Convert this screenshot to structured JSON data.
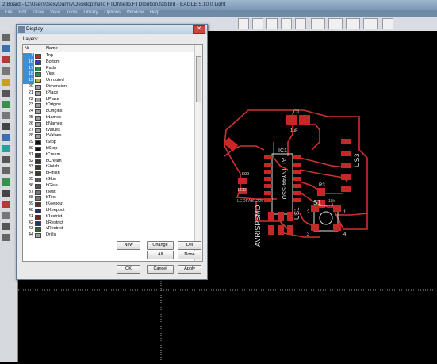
{
  "window": {
    "title": "2 Board - C:\\Users\\SexyDanny\\Desktop\\hello FTDI\\hello.FTDIbutton.fab.brd - EAGLE 5.10.0 Light"
  },
  "menu": [
    "File",
    "Edit",
    "Draw",
    "View",
    "Tools",
    "Library",
    "Options",
    "Window",
    "Help"
  ],
  "dialog": {
    "title": "Display",
    "layers_label": "Layers:",
    "columns": {
      "nr": "Nr",
      "name": "Name"
    },
    "layers": [
      {
        "nr": "1",
        "name": "Top",
        "color": "#c62828",
        "sel": true
      },
      {
        "nr": "16",
        "name": "Bottom",
        "color": "#1e3fcf",
        "sel": true
      },
      {
        "nr": "17",
        "name": "Pads",
        "color": "#2a8f4a",
        "sel": true
      },
      {
        "nr": "18",
        "name": "Vias",
        "color": "#2a8f4a",
        "sel": true
      },
      {
        "nr": "19",
        "name": "Unrouted",
        "color": "#c2b13a",
        "sel": true
      },
      {
        "nr": "20",
        "name": "Dimension",
        "color": "#9e9e9e"
      },
      {
        "nr": "21",
        "name": "tPlace",
        "color": "#9e9e9e"
      },
      {
        "nr": "22",
        "name": "bPlace",
        "color": "#9e9e9e"
      },
      {
        "nr": "23",
        "name": "tOrigins",
        "color": "#9e9e9e"
      },
      {
        "nr": "24",
        "name": "bOrigins",
        "color": "#9e9e9e"
      },
      {
        "nr": "25",
        "name": "tNames",
        "color": "#9e9e9e"
      },
      {
        "nr": "26",
        "name": "bNames",
        "color": "#9e9e9e"
      },
      {
        "nr": "27",
        "name": "tValues",
        "color": "#9e9e9e"
      },
      {
        "nr": "28",
        "name": "bValues",
        "color": "#9e9e9e"
      },
      {
        "nr": "29",
        "name": "tStop",
        "color": "#111"
      },
      {
        "nr": "30",
        "name": "bStop",
        "color": "#111"
      },
      {
        "nr": "31",
        "name": "tCream",
        "color": "#333"
      },
      {
        "nr": "32",
        "name": "bCream",
        "color": "#333"
      },
      {
        "nr": "33",
        "name": "tFinish",
        "color": "#3a3a2a"
      },
      {
        "nr": "34",
        "name": "bFinish",
        "color": "#3a3a2a"
      },
      {
        "nr": "35",
        "name": "tGlue",
        "color": "#555"
      },
      {
        "nr": "36",
        "name": "bGlue",
        "color": "#555"
      },
      {
        "nr": "37",
        "name": "tTest",
        "color": "#777"
      },
      {
        "nr": "38",
        "name": "bTest",
        "color": "#777"
      },
      {
        "nr": "39",
        "name": "tKeepout",
        "color": "#7a1f1f"
      },
      {
        "nr": "40",
        "name": "bKeepout",
        "color": "#1f2f7a"
      },
      {
        "nr": "41",
        "name": "tRestrict",
        "color": "#7a1f1f"
      },
      {
        "nr": "42",
        "name": "bRestrict",
        "color": "#1f2f7a"
      },
      {
        "nr": "43",
        "name": "vRestrict",
        "color": "#1f6a2f"
      },
      {
        "nr": "44",
        "name": "Drills",
        "color": "#9e9e9e"
      }
    ],
    "buttons": {
      "new": "New",
      "change": "Change",
      "del": "Del",
      "all": "All",
      "none": "None",
      "ok": "OK",
      "cancel": "Cancel",
      "apply": "Apply"
    }
  },
  "board": {
    "labels": {
      "c1": "C1",
      "c1v": "1uF",
      "ic1": "IC1",
      "ic1v": "ATTINY44-SSU",
      "us3": "US3",
      "r3": "R3",
      "r3v": "10k",
      "s1": "S1",
      "s1v": "6MM_SWITCH",
      "led": "LED",
      "ledv": "LEDFAB1206",
      "r": "500",
      "isp": "AVRISPSMD",
      "p3": "3",
      "p4": "4",
      "p1": "1",
      "p2": "2"
    }
  },
  "colors": {
    "trace": "#d03030",
    "pad": "#c62828",
    "silk": "#dddddd"
  }
}
